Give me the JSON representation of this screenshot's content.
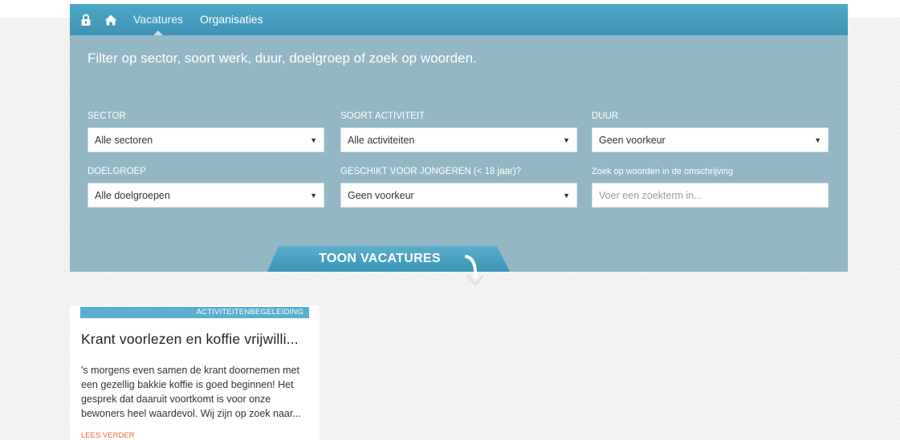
{
  "nav": {
    "lock_icon": "lock-icon",
    "home_icon": "home-icon",
    "items": [
      {
        "label": "Vacatures",
        "active": true
      },
      {
        "label": "Organisaties",
        "active": false
      }
    ]
  },
  "filter": {
    "intro": "Filter op sector, soort werk, duur, doelgroep of zoek op woorden.",
    "sector": {
      "label": "SECTOR",
      "value": "Alle sectoren"
    },
    "activiteit": {
      "label": "SOORT ACTIVITEIT",
      "value": "Alle activiteiten"
    },
    "duur": {
      "label": "DUUR",
      "value": "Geen voorkeur"
    },
    "doelgroep": {
      "label": "DOELGROEP",
      "value": "Alle doelgroepen"
    },
    "jongeren": {
      "label": "GESCHIKT VOOR JONGEREN (< 18 jaar)?",
      "value": "Geen voorkeur"
    },
    "zoek": {
      "label": "Zoek op woorden in de omschrijving",
      "placeholder": "Voer een zoekterm in..."
    },
    "submit_label": "TOON VACATURES"
  },
  "results": [
    {
      "category": "ACTIVITEITENBEGELEIDING",
      "title": "Krant voorlezen en koffie vrijwilli...",
      "excerpt": "'s morgens even samen de krant doornemen met een gezellig bakkie koffie is goed beginnen! Het gesprek dat daaruit voortkomt is voor onze bewoners heel waardevol. Wij zijn op zoek naar...",
      "more_label": "LEES VERDER"
    }
  ],
  "colors": {
    "nav_bg": "#4fa8c8",
    "panel_bg": "#93b7c5",
    "category_bg": "#59afd0",
    "link_accent": "#e2673d"
  }
}
